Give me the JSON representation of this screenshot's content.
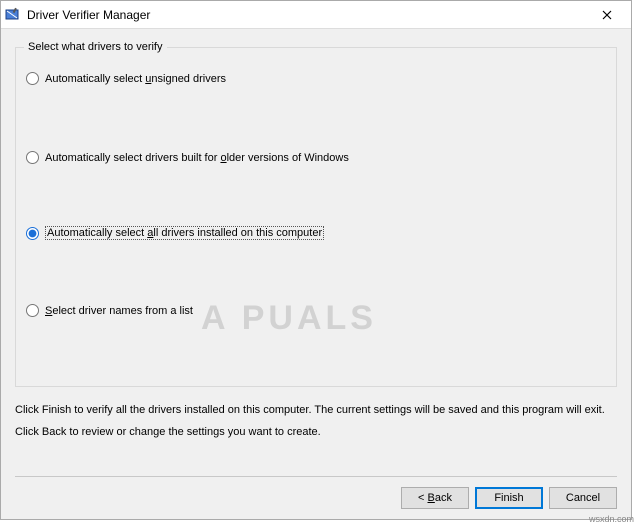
{
  "window": {
    "title": "Driver Verifier Manager"
  },
  "group": {
    "legend": "Select what drivers to verify",
    "options": {
      "unsigned": "Automatically select unsigned drivers",
      "older": "Automatically select drivers built for older versions of Windows",
      "all": "Automatically select all drivers installed on this computer",
      "list": "Select driver names from a list"
    },
    "selected": "all"
  },
  "help": {
    "line1": "Click Finish to verify all the drivers installed on this computer. The current settings will be saved and this program will exit.",
    "line2": "Click Back to review or change the settings you want to create."
  },
  "buttons": {
    "back": "< Back",
    "finish": "Finish",
    "cancel": "Cancel"
  },
  "watermark": "A   PUALS",
  "attribution": "wsxdn.com"
}
